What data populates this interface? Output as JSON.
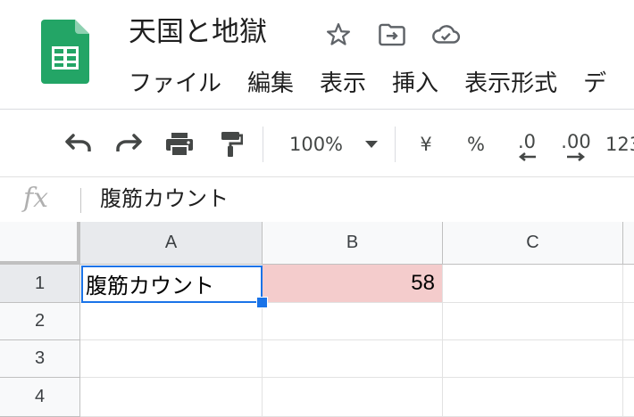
{
  "document": {
    "title": "天国と地獄",
    "star_icon": "star-icon",
    "move_icon": "folder-move-icon",
    "cloud_icon": "cloud-saved-icon",
    "logo_icon": "sheets-logo-icon"
  },
  "menu": {
    "items": [
      "ファイル",
      "編集",
      "表示",
      "挿入",
      "表示形式",
      "デ"
    ]
  },
  "toolbar": {
    "undo_icon": "undo-icon",
    "redo_icon": "redo-icon",
    "print_icon": "print-icon",
    "paint_format_icon": "paint-format-icon",
    "zoom": "100%",
    "currency_label": "¥",
    "percent_label": "%",
    "decrease_decimal_label": ".0",
    "increase_decimal_label": ".00",
    "more_formats_label": "123"
  },
  "formula_bar": {
    "fx_label": "fx",
    "content": "腹筋カウント"
  },
  "grid": {
    "columns": [
      "A",
      "B",
      "C"
    ],
    "rows": [
      "1",
      "2",
      "3",
      "4"
    ],
    "cells": {
      "A1": "腹筋カウント",
      "B1": "58"
    },
    "highlight_color": "#f4cccc",
    "selection_color": "#1a73e8"
  }
}
